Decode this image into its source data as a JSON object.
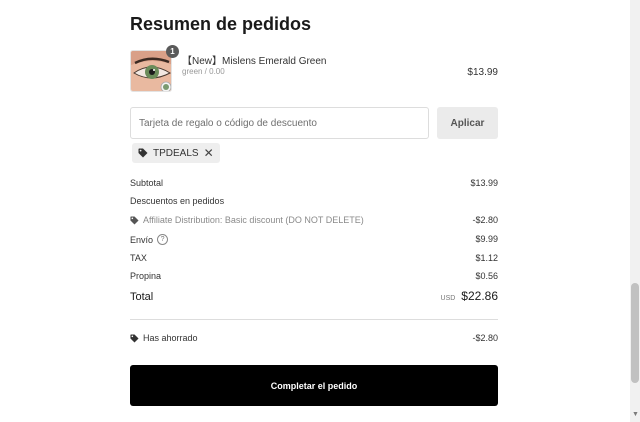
{
  "summary": {
    "title": "Resumen de pedidos"
  },
  "item": {
    "qty": "1",
    "name": "【New】Mislens Emerald Green",
    "variant": "green / 0.00",
    "price": "$13.99",
    "thumb_icon": "contact-lens-eye-thumbnail"
  },
  "discount": {
    "placeholder": "Tarjeta de regalo o código de descuento",
    "apply_label": "Aplicar",
    "applied_code": "TPDEALS",
    "tag_icon": "tag-icon",
    "remove_icon": "close-icon"
  },
  "totals": {
    "subtotal_label": "Subtotal",
    "subtotal_value": "$13.99",
    "discounts_label": "Descuentos en pedidos",
    "affiliate_label": "Affiliate Distribution: Basic discount (DO NOT DELETE)",
    "affiliate_value": "-$2.80",
    "shipping_label": "Envío",
    "shipping_value": "$9.99",
    "tax_label": "TAX",
    "tax_value": "$1.12",
    "tip_label": "Propina",
    "tip_value": "$0.56",
    "total_label": "Total",
    "currency": "USD",
    "total_value": "$22.86",
    "saved_label": "Has ahorrado",
    "saved_value": "-$2.80"
  },
  "cta": {
    "label": "Completar el pedido"
  },
  "colors": {
    "cta_bg": "#000000",
    "chip_bg": "#eeeeee",
    "apply_bg": "#ebebeb"
  }
}
